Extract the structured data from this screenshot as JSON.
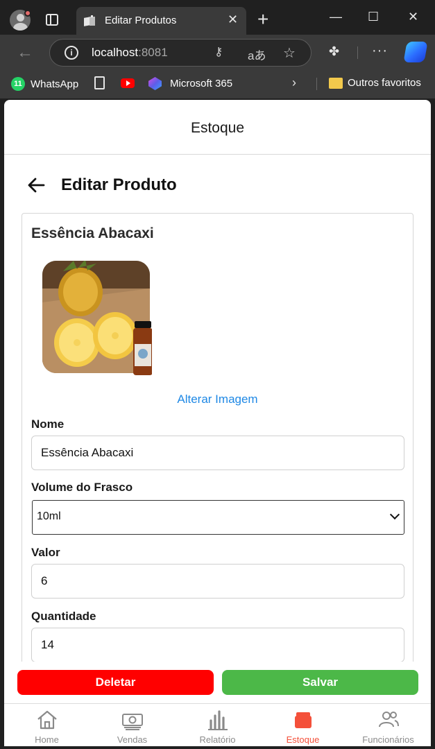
{
  "browser": {
    "tab_title": "Editar Produtos",
    "url_host": "localhost",
    "url_port": ":8081",
    "new_tab": "+",
    "window_controls": {
      "minimize": "—",
      "maximize": "☐",
      "close": "✕"
    }
  },
  "bookmarks": [
    {
      "label": "WhatsApp",
      "icon": "whatsapp-icon",
      "badge": "11"
    },
    {
      "label": "",
      "icon": "document-icon"
    },
    {
      "label": "",
      "icon": "youtube-icon"
    },
    {
      "label": "Microsoft 365",
      "icon": "microsoft365-icon"
    },
    {
      "label": "Outros favoritos",
      "icon": "folder-icon"
    }
  ],
  "app": {
    "header_title": "Estoque",
    "page_title": "Editar Produto",
    "product": {
      "name": "Essência Abacaxi",
      "change_image_label": "Alterar Imagem"
    },
    "fields": {
      "nome": {
        "label": "Nome",
        "value": "Essência Abacaxi"
      },
      "volume": {
        "label": "Volume do Frasco",
        "value": "10ml"
      },
      "valor": {
        "label": "Valor",
        "value": "6"
      },
      "quantidade": {
        "label": "Quantidade",
        "value": "14"
      }
    },
    "actions": {
      "delete": "Deletar",
      "save": "Salvar"
    },
    "nav": [
      {
        "label": "Home",
        "icon": "home-icon"
      },
      {
        "label": "Vendas",
        "icon": "cash-icon"
      },
      {
        "label": "Relatório",
        "icon": "bar-chart-icon"
      },
      {
        "label": "Estoque",
        "icon": "box-icon",
        "active": true
      },
      {
        "label": "Funcionários",
        "icon": "people-icon"
      }
    ],
    "colors": {
      "accent": "#f4503a",
      "delete": "#ff0000",
      "save": "#4cb848",
      "link": "#1e88e5"
    }
  }
}
